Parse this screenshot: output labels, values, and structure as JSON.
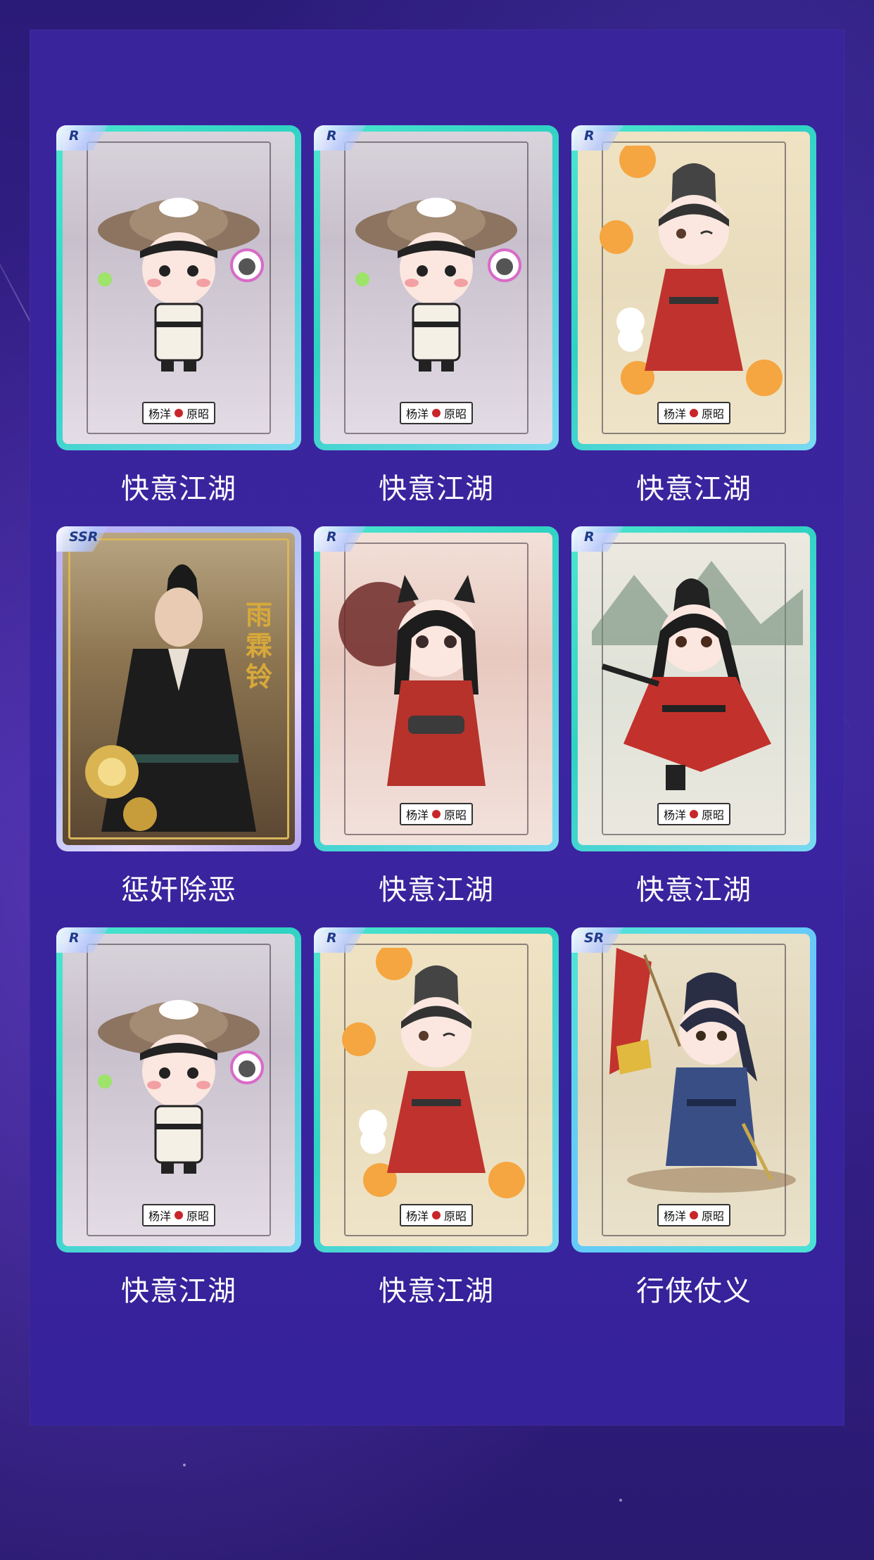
{
  "colors": {
    "background": "#2a1a73",
    "panel": "#3a249b",
    "card_border_r": "#2fd3c2",
    "card_border_ssr": "#c6b2f5",
    "title_text": "#ffffff"
  },
  "cards": [
    {
      "rarity": "R",
      "title": "快意江湖",
      "art": "hat-cat-character",
      "seal": [
        "杨洋",
        "原昭"
      ]
    },
    {
      "rarity": "R",
      "title": "快意江湖",
      "art": "hat-cat-character",
      "seal": [
        "杨洋",
        "原昭"
      ]
    },
    {
      "rarity": "R",
      "title": "快意江湖",
      "art": "winking-red-robe-character",
      "seal": [
        "杨洋",
        "原昭"
      ]
    },
    {
      "rarity": "SSR",
      "title": "惩奸除恶",
      "art": "photo-black-robe-actor",
      "calligraphy": "雨霖铃"
    },
    {
      "rarity": "R",
      "title": "快意江湖",
      "art": "red-robe-cat-ear-character",
      "seal": [
        "杨洋",
        "原昭"
      ]
    },
    {
      "rarity": "R",
      "title": "快意江湖",
      "art": "running-red-robe-character",
      "seal": [
        "杨洋",
        "原昭"
      ]
    },
    {
      "rarity": "R",
      "title": "快意江湖",
      "art": "hat-cat-character",
      "seal": [
        "杨洋",
        "原昭"
      ]
    },
    {
      "rarity": "R",
      "title": "快意江湖",
      "art": "winking-red-robe-character",
      "seal": [
        "杨洋",
        "原昭"
      ]
    },
    {
      "rarity": "SR",
      "title": "行侠仗义",
      "art": "blue-robe-flag-character",
      "seal": [
        "杨洋",
        "原昭"
      ]
    }
  ]
}
